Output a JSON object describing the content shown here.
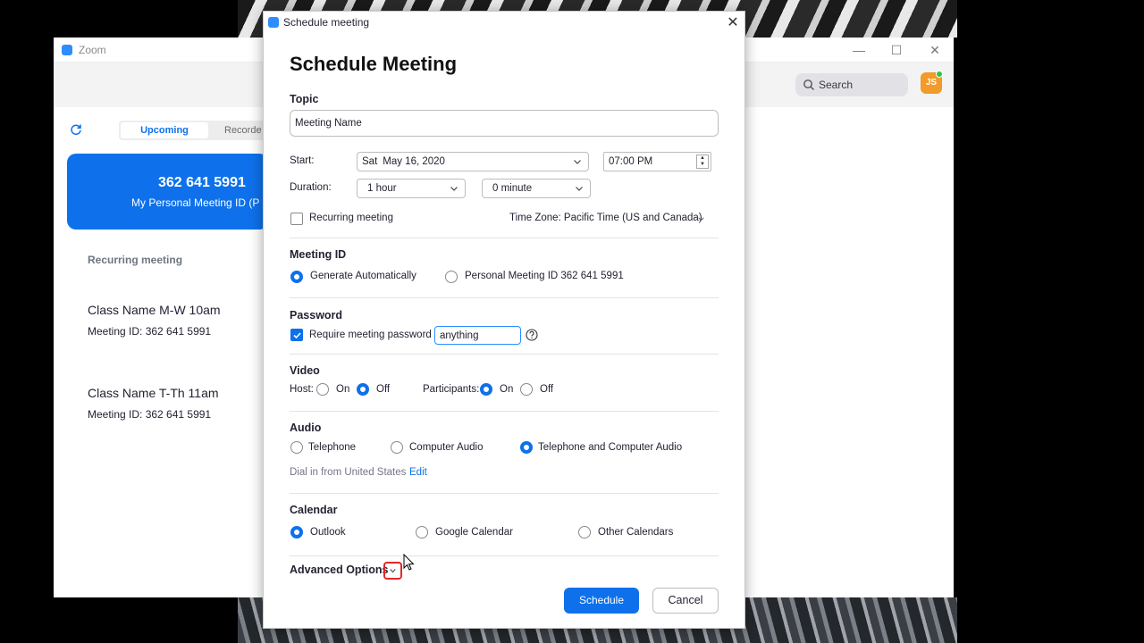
{
  "main_window": {
    "title": "Zoom",
    "search_label": "Search",
    "avatar_initials": "JS",
    "tabs": [
      "Upcoming",
      "Recorde"
    ],
    "pmi": {
      "number": "362 641 5991",
      "label": "My Personal Meeting ID (P"
    },
    "list_section": "Recurring meeting",
    "meetings": [
      {
        "title": "Class Name M-W 10am",
        "id": "Meeting ID: 362 641 5991"
      },
      {
        "title": "Class Name T-Th 11am",
        "id": "Meeting ID: 362 641 5991"
      }
    ]
  },
  "dialog": {
    "window_title": "Schedule meeting",
    "heading": "Schedule Meeting",
    "topic_label": "Topic",
    "topic_value": "Meeting Name",
    "start_label": "Start:",
    "start_day": "Sat",
    "start_date": "May 16, 2020",
    "start_time": "07:00 PM",
    "duration_label": "Duration:",
    "duration_hours": "1 hour",
    "duration_minutes": "0 minute",
    "recurring_label": "Recurring meeting",
    "timezone": "Time Zone: Pacific Time (US and Canada)",
    "meeting_id_label": "Meeting ID",
    "generate_auto": "Generate Automatically",
    "personal_id": "Personal Meeting ID 362 641 5991",
    "password_label": "Password",
    "require_password": "Require meeting password",
    "password_value": "anything",
    "video_label": "Video",
    "host_label": "Host:",
    "participants_label": "Participants:",
    "on": "On",
    "off": "Off",
    "audio_label": "Audio",
    "audio_telephone": "Telephone",
    "audio_computer": "Computer Audio",
    "audio_both": "Telephone and Computer Audio",
    "dial_in": "Dial in from United States",
    "edit": "Edit",
    "calendar_label": "Calendar",
    "cal_outlook": "Outlook",
    "cal_google": "Google Calendar",
    "cal_other": "Other Calendars",
    "advanced": "Advanced Options",
    "schedule_btn": "Schedule",
    "cancel_btn": "Cancel"
  },
  "colors": {
    "accent": "#0e71eb",
    "highlight": "#e02828"
  }
}
